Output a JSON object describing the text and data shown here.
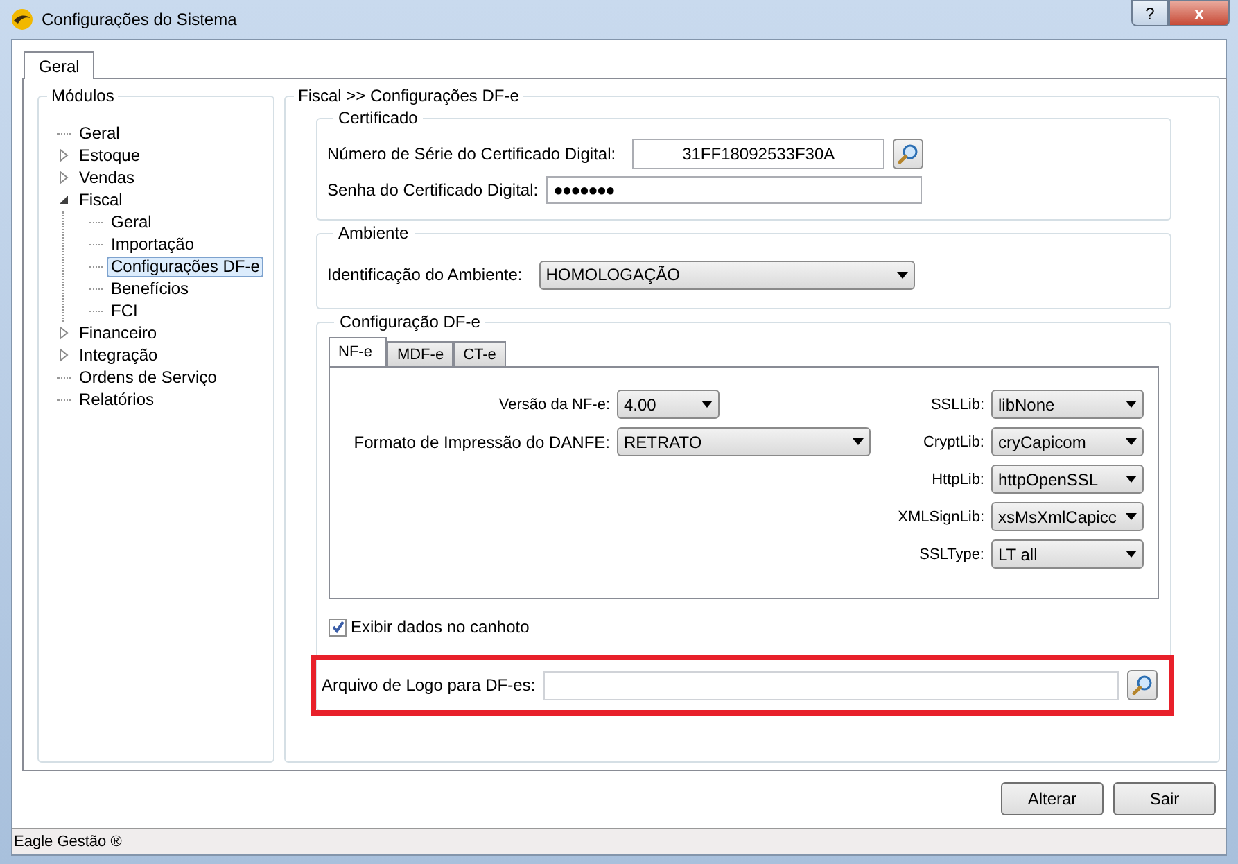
{
  "window": {
    "title": "Configurações do Sistema",
    "help_button": "?",
    "close_button": "x"
  },
  "tabs": [
    {
      "label": "Geral",
      "selected": true
    }
  ],
  "modules": {
    "title": "Módulos",
    "tree": [
      {
        "label": "Geral",
        "selected": false
      },
      {
        "label": "Estoque",
        "expanded": false,
        "selected": false
      },
      {
        "label": "Vendas",
        "expanded": false,
        "selected": false
      },
      {
        "label": "Fiscal",
        "expanded": true,
        "selected": false,
        "children": [
          {
            "label": "Geral",
            "selected": false
          },
          {
            "label": "Importação",
            "selected": false
          },
          {
            "label": "Configurações DF-e",
            "selected": true
          },
          {
            "label": "Benefícios",
            "selected": false
          },
          {
            "label": "FCI",
            "selected": false
          }
        ]
      },
      {
        "label": "Financeiro",
        "expanded": false,
        "selected": false
      },
      {
        "label": "Integração",
        "expanded": false,
        "selected": false
      },
      {
        "label": "Ordens de Serviço",
        "selected": false
      },
      {
        "label": "Relatórios",
        "selected": false
      }
    ]
  },
  "breadcrumb": "Fiscal >> Configurações DF-e",
  "certificado": {
    "title": "Certificado",
    "serial_label": "Número de Série do Certificado Digital:",
    "serial_value": "31FF18092533F30A",
    "password_label": "Senha do Certificado Digital:",
    "password_value": "●●●●●●●"
  },
  "ambiente": {
    "title": "Ambiente",
    "label": "Identificação do Ambiente:",
    "value": "HOMOLOGAÇÃO"
  },
  "dfe": {
    "title": "Configuração DF-e",
    "tabs": [
      {
        "label": "NF-e",
        "selected": true
      },
      {
        "label": "MDF-e",
        "selected": false
      },
      {
        "label": "CT-e",
        "selected": false
      }
    ],
    "left_fields": [
      {
        "label": "Versão da NF-e:",
        "value": "4.00",
        "kind": "short"
      },
      {
        "label": "Formato de Impressão do DANFE:",
        "value": "RETRATO",
        "kind": "wide"
      }
    ],
    "lib_fields": [
      {
        "label": "SSLLib:",
        "value": "libNone"
      },
      {
        "label": "CryptLib:",
        "value": "cryCapicom"
      },
      {
        "label": "HttpLib:",
        "value": "httpOpenSSL"
      },
      {
        "label": "XMLSignLib:",
        "value": "xsMsXmlCapicc"
      },
      {
        "label": "SSLType:",
        "value": "LT all"
      }
    ],
    "checkbox": {
      "label": "Exibir dados no canhoto",
      "checked": true
    }
  },
  "logo": {
    "label": "Arquivo de Logo para DF-es:"
  },
  "buttons": [
    "Alterar",
    "Sair"
  ],
  "status_bar": "Eagle Gestão ®"
}
